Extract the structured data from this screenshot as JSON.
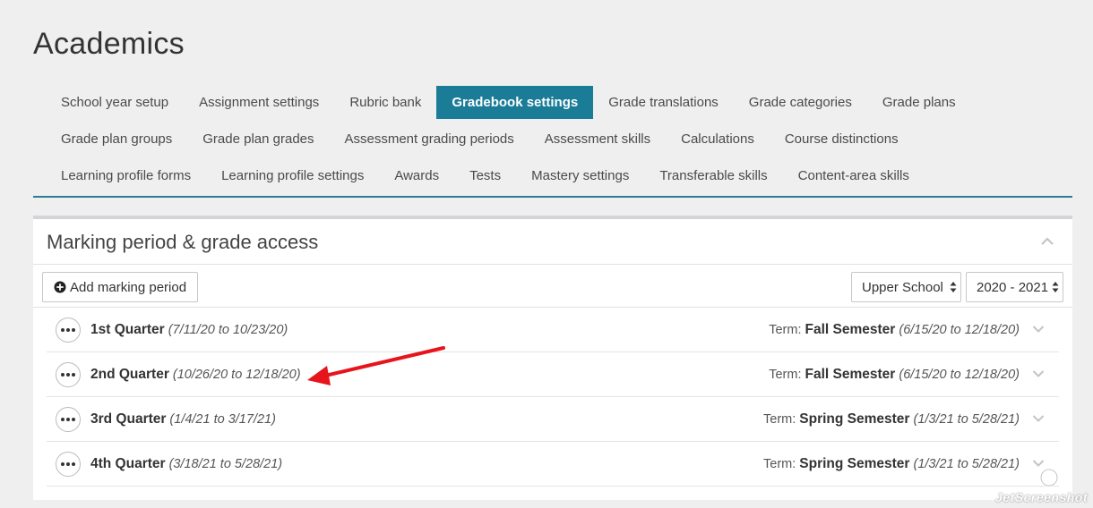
{
  "page": {
    "title": "Academics"
  },
  "tabs": [
    [
      {
        "label": "School year setup",
        "active": false
      },
      {
        "label": "Assignment settings",
        "active": false
      },
      {
        "label": "Rubric bank",
        "active": false
      },
      {
        "label": "Gradebook settings",
        "active": true
      },
      {
        "label": "Grade translations",
        "active": false
      },
      {
        "label": "Grade categories",
        "active": false
      },
      {
        "label": "Grade plans",
        "active": false
      }
    ],
    [
      {
        "label": "Grade plan groups",
        "active": false
      },
      {
        "label": "Grade plan grades",
        "active": false
      },
      {
        "label": "Assessment grading periods",
        "active": false
      },
      {
        "label": "Assessment skills",
        "active": false
      },
      {
        "label": "Calculations",
        "active": false
      },
      {
        "label": "Course distinctions",
        "active": false
      }
    ],
    [
      {
        "label": "Learning profile forms",
        "active": false
      },
      {
        "label": "Learning profile settings",
        "active": false
      },
      {
        "label": "Awards",
        "active": false
      },
      {
        "label": "Tests",
        "active": false
      },
      {
        "label": "Mastery settings",
        "active": false
      },
      {
        "label": "Transferable skills",
        "active": false
      },
      {
        "label": "Content-area skills",
        "active": false
      }
    ]
  ],
  "panel": {
    "title": "Marking period & grade access",
    "add_button_label": "Add marking period",
    "school_select": "Upper School",
    "year_select": "2020 - 2021",
    "term_label": "Term:",
    "rows": [
      {
        "name": "1st Quarter",
        "dates": "(7/11/20 to 10/23/20)",
        "term": "Fall Semester",
        "term_dates": "(6/15/20 to 12/18/20)"
      },
      {
        "name": "2nd Quarter",
        "dates": "(10/26/20 to 12/18/20)",
        "term": "Fall Semester",
        "term_dates": "(6/15/20 to 12/18/20)"
      },
      {
        "name": "3rd Quarter",
        "dates": "(1/4/21 to 3/17/21)",
        "term": "Spring Semester",
        "term_dates": "(1/3/21 to 5/28/21)"
      },
      {
        "name": "4th Quarter",
        "dates": "(3/18/21 to 5/28/21)",
        "term": "Spring Semester",
        "term_dates": "(1/3/21 to 5/28/21)"
      }
    ]
  },
  "colors": {
    "accent": "#1a7c96",
    "annotation": "#e8141c"
  },
  "icons": {
    "add": "plus-circle-icon",
    "collapse": "chevron-up-icon",
    "expand": "chevron-down-icon",
    "more": "ellipsis-icon"
  },
  "watermark": "JetScreenshot"
}
